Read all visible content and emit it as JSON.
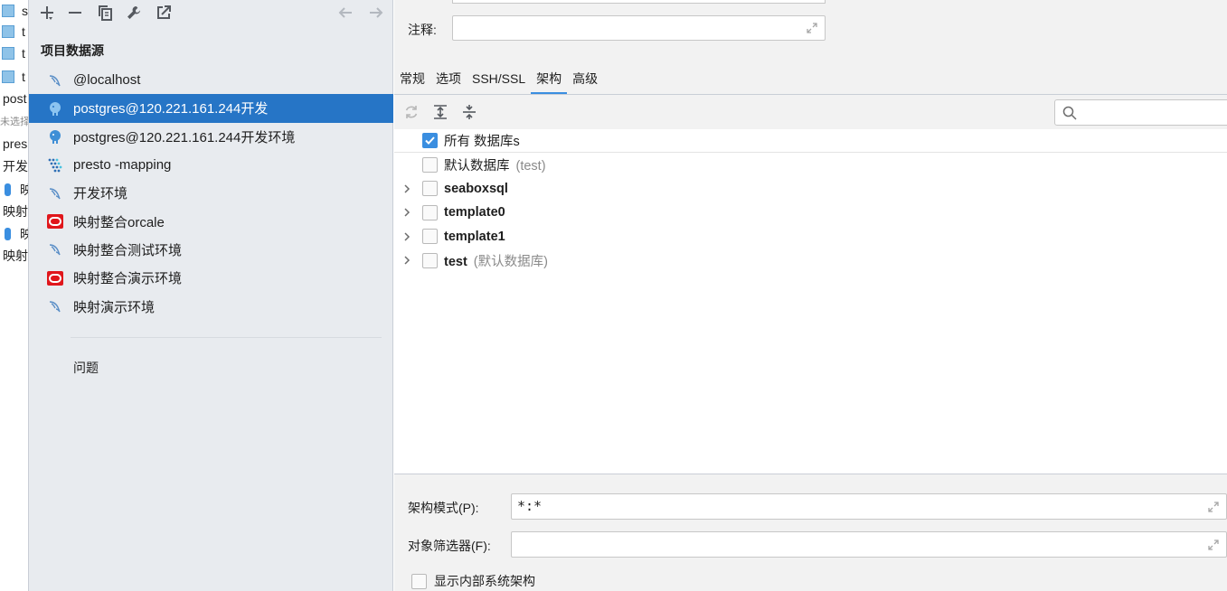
{
  "background_list": {
    "items": [
      {
        "text": "s",
        "kind": "table"
      },
      {
        "text": "t",
        "kind": "table"
      },
      {
        "text": "t",
        "kind": "table"
      },
      {
        "text": "t",
        "kind": "table"
      },
      {
        "text": "post",
        "kind": "text"
      },
      {
        "text": "未选择",
        "kind": "small"
      },
      {
        "text": "pres",
        "kind": "text"
      },
      {
        "text": "开发",
        "kind": "text"
      },
      {
        "text": "映",
        "kind": "pill"
      },
      {
        "text": "映射",
        "kind": "text"
      },
      {
        "text": "映",
        "kind": "pill"
      },
      {
        "text": "映射",
        "kind": "text"
      }
    ]
  },
  "left_panel": {
    "toolbar": {
      "add": "plus-icon",
      "remove": "minus-icon",
      "copy": "copy-icon",
      "edit": "wrench-icon",
      "open": "external-link-icon",
      "back": "arrow-left-icon",
      "forward": "arrow-right-icon"
    },
    "section_title": "项目数据源",
    "datasources": [
      {
        "label": "@localhost",
        "icon": "mysql-dolphin-icon",
        "selected": false
      },
      {
        "label": "postgres@120.221.161.244开发",
        "icon": "postgresql-elephant-icon",
        "selected": true
      },
      {
        "label": "postgres@120.221.161.244开发环境",
        "icon": "postgresql-elephant-icon",
        "selected": false
      },
      {
        "label": "presto -mapping",
        "icon": "presto-icon",
        "selected": false
      },
      {
        "label": "开发环境",
        "icon": "mysql-dolphin-icon",
        "selected": false
      },
      {
        "label": "映射整合orcale",
        "icon": "oracle-icon",
        "selected": false
      },
      {
        "label": "映射整合测试环境",
        "icon": "mysql-dolphin-icon",
        "selected": false
      },
      {
        "label": "映射整合演示环境",
        "icon": "oracle-icon",
        "selected": false
      },
      {
        "label": "映射演示环境",
        "icon": "mysql-dolphin-icon",
        "selected": false
      }
    ],
    "problems_label": "问题"
  },
  "right_panel": {
    "comment_label": "注释:",
    "comment_value": "",
    "tabs": [
      {
        "label": "常规",
        "active": false
      },
      {
        "label": "选项",
        "active": false
      },
      {
        "label": "SSH/SSL",
        "active": false
      },
      {
        "label": "架构",
        "active": true
      },
      {
        "label": "高级",
        "active": false
      }
    ],
    "schema_toolbar": {
      "refresh": "refresh-icon",
      "expand_all": "expand-all-icon",
      "collapse_all": "collapse-all-icon",
      "search_placeholder": ""
    },
    "databases": [
      {
        "name": "所有 数据库s",
        "note": "",
        "checked": true,
        "bold": false,
        "expandable": false
      },
      {
        "name": "默认数据库",
        "note": "(test)",
        "checked": false,
        "bold": false,
        "expandable": false
      },
      {
        "name": "seaboxsql",
        "note": "",
        "checked": false,
        "bold": true,
        "expandable": true
      },
      {
        "name": "template0",
        "note": "",
        "checked": false,
        "bold": true,
        "expandable": true
      },
      {
        "name": "template1",
        "note": "",
        "checked": false,
        "bold": true,
        "expandable": true
      },
      {
        "name": "test",
        "note": "(默认数据库)",
        "checked": false,
        "bold": true,
        "expandable": true
      }
    ],
    "schema_pattern_label": "架构模式(P):",
    "schema_pattern_value": "*:*",
    "object_filter_label": "对象筛选器(F):",
    "object_filter_value": "",
    "show_internal_label": "显示内部系统架构",
    "show_internal_checked": false
  },
  "colors": {
    "selection": "#2675c6",
    "accent": "#3a8ee0",
    "panel_bg": "#e8ebef",
    "oracle_red": "#e0161b"
  }
}
